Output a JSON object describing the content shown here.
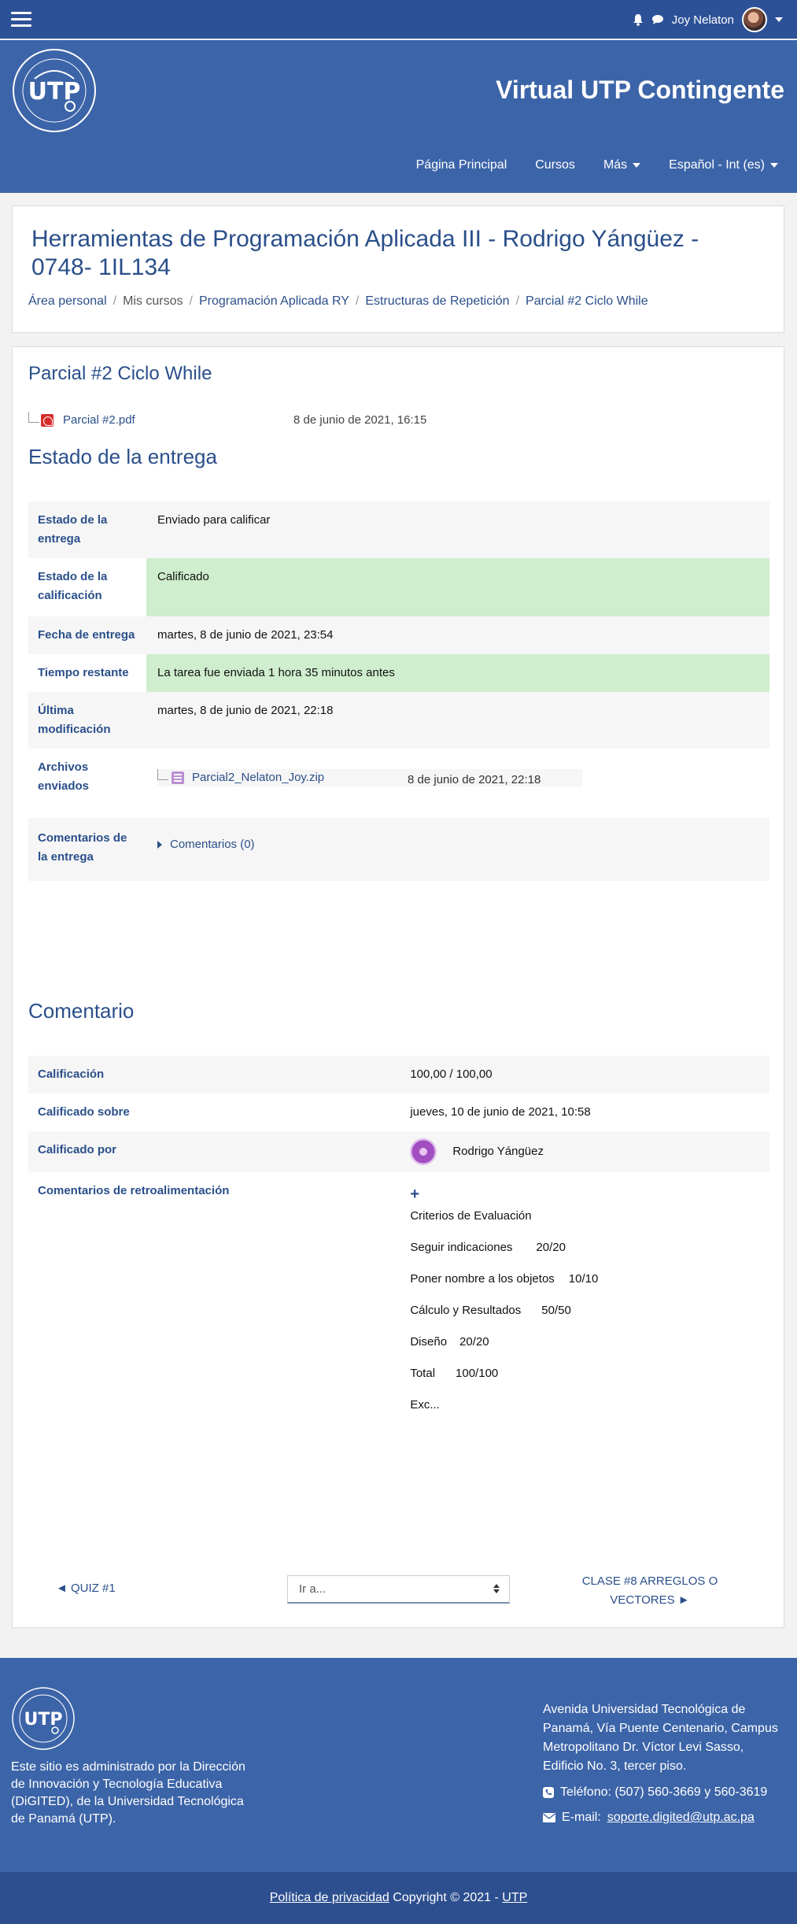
{
  "header": {
    "user_name": "Joy Nelaton",
    "site_title": "Virtual UTP Contingente",
    "menu": [
      "Página Principal",
      "Cursos",
      "Más",
      "Español - Int (es)"
    ]
  },
  "course": {
    "title": "Herramientas de Programación Aplicada III - Rodrigo Yángüez - 0748- 1IL134",
    "breadcrumb": [
      "Área personal",
      "Mis cursos",
      "Programación Aplicada RY",
      "Estructuras de Repetición",
      "Parcial #2 Ciclo While"
    ]
  },
  "assignment": {
    "title": "Parcial #2 Ciclo While",
    "file_name": "Parcial #2.pdf",
    "file_date": "8 de junio de 2021, 16:15"
  },
  "submission": {
    "heading": "Estado de la entrega",
    "rows": [
      {
        "label": "Estado de la entrega",
        "value": "Enviado para calificar"
      },
      {
        "label": "Estado de la calificación",
        "value": "Calificado"
      },
      {
        "label": "Fecha de entrega",
        "value": "martes, 8 de junio de 2021, 23:54"
      },
      {
        "label": "Tiempo restante",
        "value": "La tarea fue enviada 1 hora 35 minutos antes"
      },
      {
        "label": "Última modificación",
        "value": "martes, 8 de junio de 2021, 22:18"
      },
      {
        "label": "Archivos enviados",
        "value": ""
      },
      {
        "label": "Comentarios de la entrega",
        "value": "Comentarios (0)"
      }
    ],
    "file_name": "Parcial2_Nelaton_Joy.zip",
    "file_date": "8 de junio de 2021, 22:18"
  },
  "feedback": {
    "heading": "Comentario",
    "grade_label": "Calificación",
    "grade_value": "100,00 / 100,00",
    "graded_on_label": "Calificado sobre",
    "graded_on_value": "jueves, 10 de junio de 2021, 10:58",
    "graded_by_label": "Calificado por",
    "graded_by_value": "Rodrigo Yángüez",
    "comments_label": "Comentarios de retroalimentación",
    "plus": "+",
    "criteria_title": "Criterios de Evaluación",
    "criteria": [
      {
        "name": "Seguir indicaciones",
        "score": "20/20"
      },
      {
        "name": "Poner nombre a los objetos",
        "score": "10/10"
      },
      {
        "name": "Cálculo y Resultados",
        "score": "50/50"
      },
      {
        "name": "Diseño",
        "score": "20/20"
      },
      {
        "name": "Total",
        "score": "100/100"
      }
    ],
    "tail": "Exc..."
  },
  "activity_nav": {
    "prev": "◄ QUIZ #1",
    "jump_placeholder": "Ir a...",
    "next": "CLASE #8 ARREGLOS O VECTORES ►"
  },
  "footer": {
    "about": "Este sitio es administrado por la Dirección de Innovación y Tecnología Educativa (DiGITED), de la Universidad Tecnológica de Panamá (UTP).",
    "address": "Avenida Universidad Tecnológica de Panamá, Vía Puente Centenario, Campus Metropolitano Dr. Víctor Levi Sasso, Edificio No. 3, tercer piso.",
    "phone": "Teléfono: (507) 560-3669 y 560-3619",
    "email_label": "E-mail:",
    "email": "soporte.digited@utp.ac.pa",
    "privacy": "Política de privacidad",
    "copyright": "Copyright © 2021 -",
    "utp": "UTP"
  },
  "colors": {
    "navbar": "#2d5197",
    "banner": "#3c64a8",
    "link": "#2a4f8a",
    "success_bg": "#cfeecd"
  }
}
